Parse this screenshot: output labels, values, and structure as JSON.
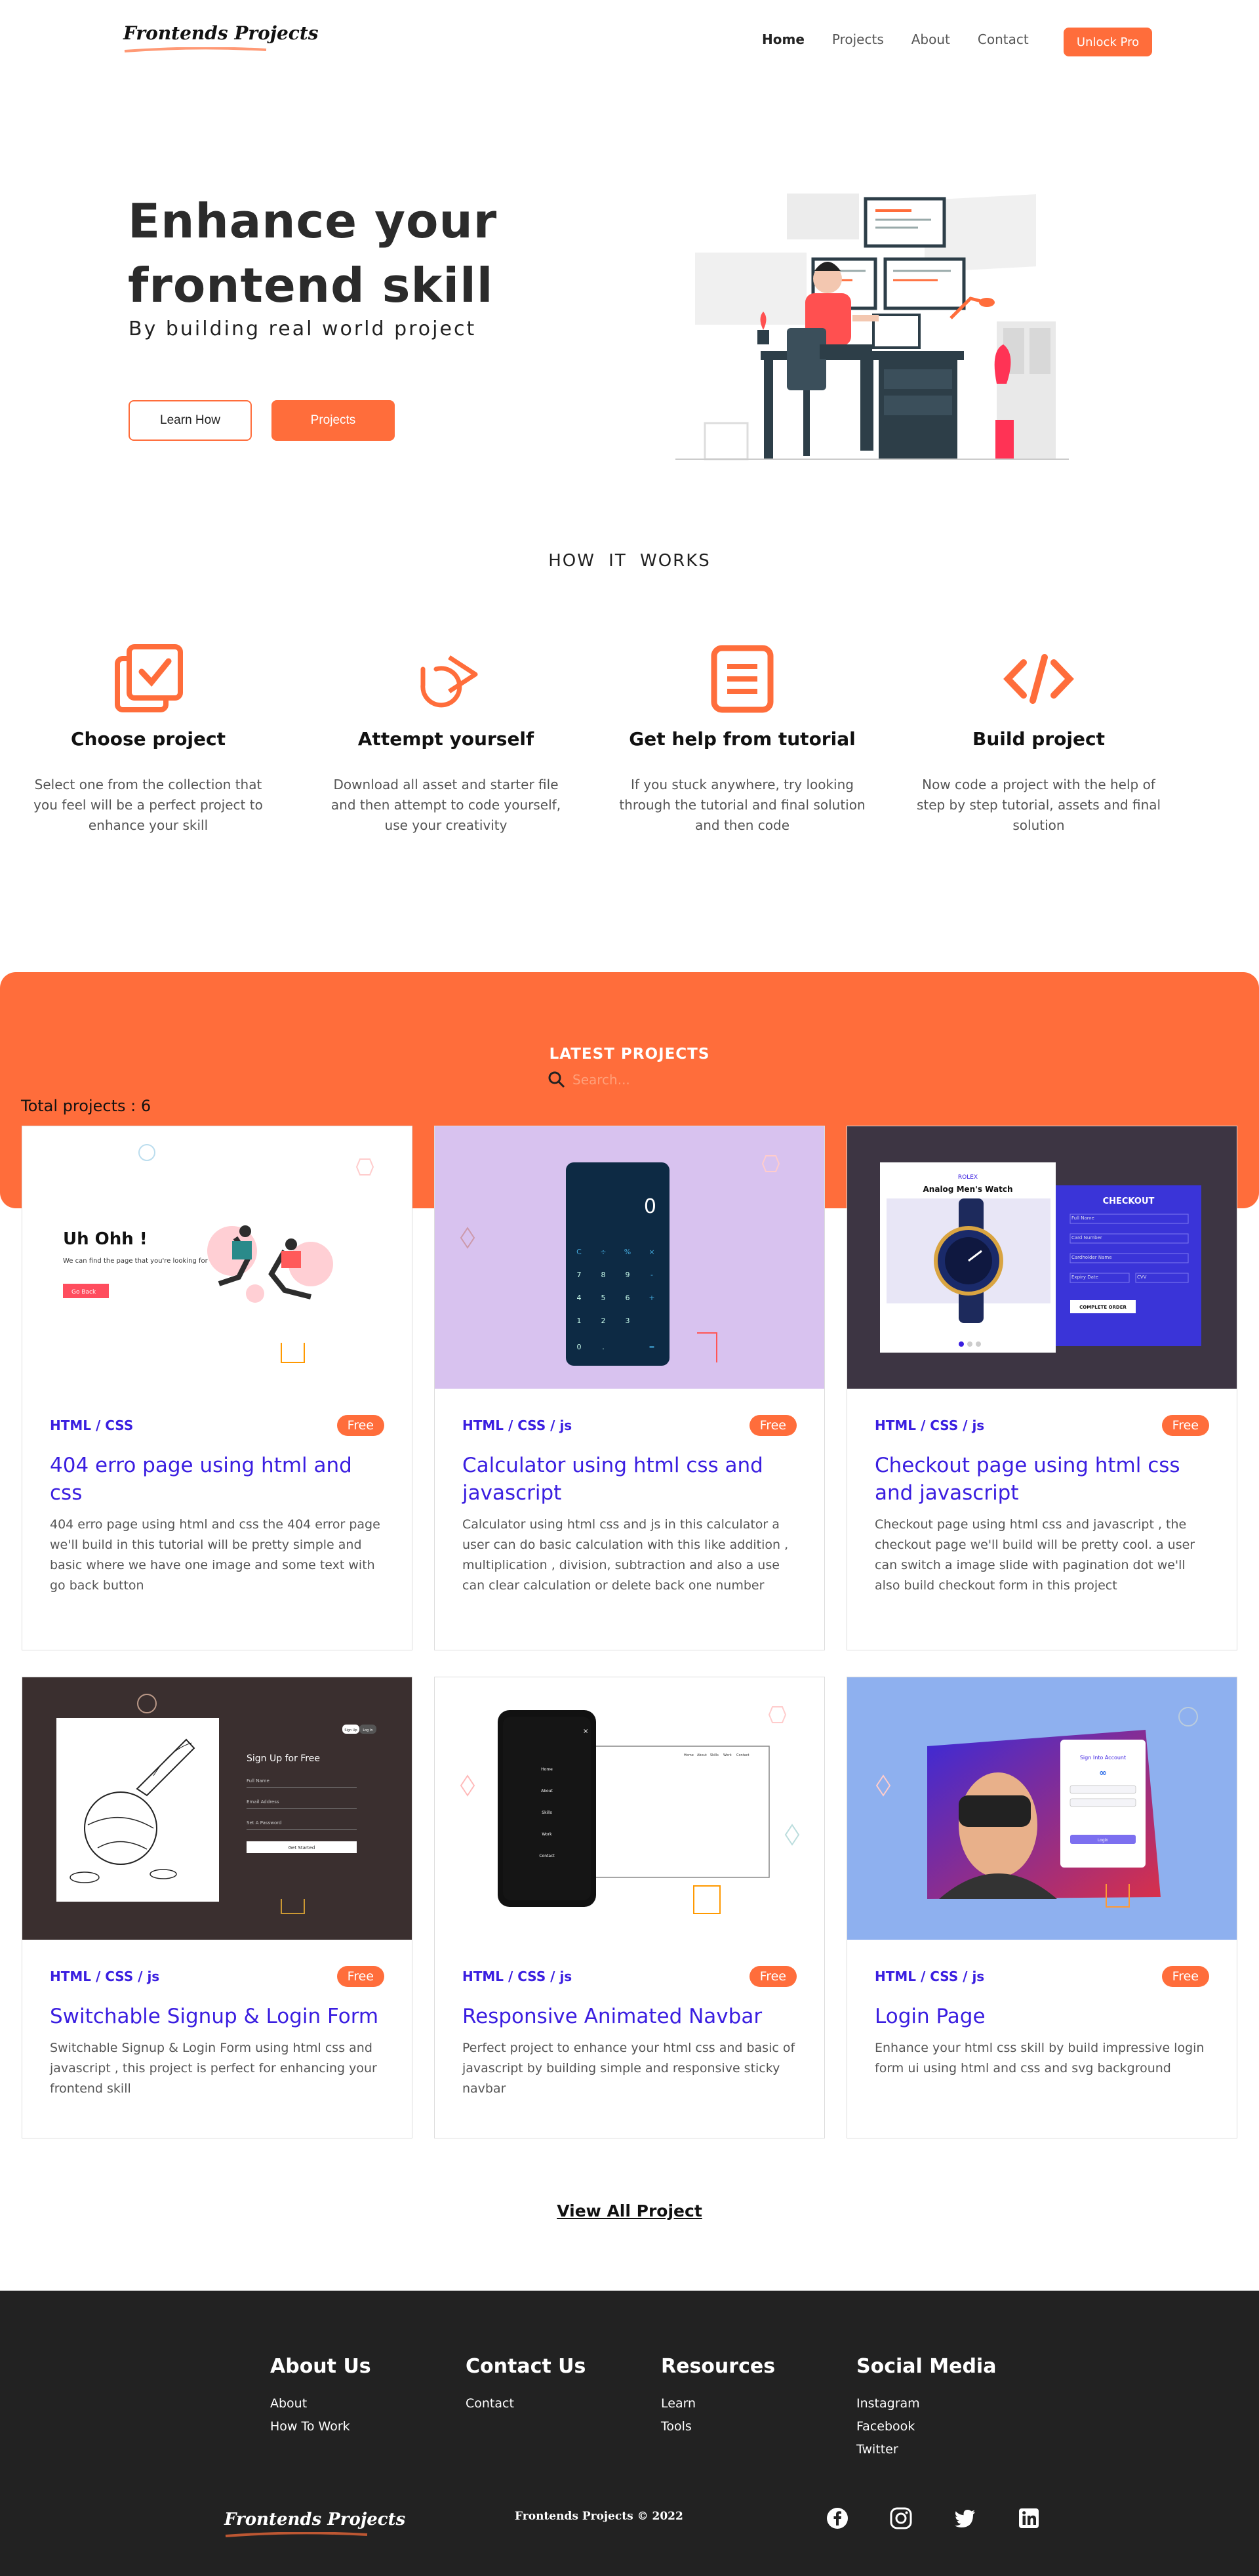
{
  "nav": {
    "logo": "Frontends Projects",
    "links": [
      "Home",
      "Projects",
      "About",
      "Contact"
    ],
    "cta": "Unlock Pro"
  },
  "hero": {
    "title": "Enhance your frontend skill",
    "subtitle": "By building real world project",
    "btn_learn": "Learn How",
    "btn_projects": "Projects"
  },
  "how": {
    "title": "HOW IT WORKS",
    "steps": [
      {
        "icon": "copy-check-icon",
        "title": "Choose project",
        "text": "Select one from the collection that you feel will be a perfect project to enhance your skill"
      },
      {
        "icon": "retry-arrow-icon",
        "title": "Attempt yourself",
        "text": "Download all asset and starter file and then attempt to code yourself, use your creativity"
      },
      {
        "icon": "document-icon",
        "title": "Get help from tutorial",
        "text": "If you stuck anywhere, try looking through the tutorial and final solution and then code"
      },
      {
        "icon": "code-icon",
        "title": "Build project",
        "text": "Now code a project with the help of step by step tutorial, assets and final solution"
      }
    ]
  },
  "latest": {
    "title": "LATEST PROJECTS",
    "search_placeholder": "Search...",
    "total": "Total projects : 6",
    "projects": [
      {
        "tech": "HTML / CSS",
        "badge": "Free",
        "title": "404 erro page using html and css",
        "desc": "404 erro page using html and css the 404 error page we'll build in this tutorial will be pretty simple and basic where we have one image and some text with go back button",
        "thumb": {
          "heading": "Uh Ohh !",
          "text": "We can find the page that you're looking for :(",
          "button": "Go Back"
        }
      },
      {
        "tech": "HTML / CSS / js",
        "badge": "Free",
        "title": "Calculator using html css and javascript",
        "desc": "Calculator using html css and js in this calculator a user can do basic calculation with this like addition , multiplication , division, subtraction and also a use can clear calculation or delete back one number",
        "thumb": {
          "display": "0",
          "keys": [
            "C",
            "÷",
            "%",
            "×",
            "7",
            "8",
            "9",
            "-",
            "4",
            "5",
            "6",
            "+",
            "1",
            "2",
            "3",
            "",
            "0",
            ".",
            "",
            "="
          ]
        }
      },
      {
        "tech": "HTML / CSS / js",
        "badge": "Free",
        "title": "Checkout page using html css and javascript",
        "desc": "Checkout page using html css and javascript , the checkout page we'll build will be pretty cool. a user can switch a image slide with pagination dot we'll also build checkout form in this project",
        "thumb": {
          "brand": "ROLEX",
          "product": "Analog Men's Watch",
          "checkout": "CHECKOUT",
          "fields": [
            "Full Name",
            "Card Number",
            "Cardholder Name",
            "Expiry Date",
            "CVV"
          ],
          "button": "COMPLETE ORDER"
        }
      },
      {
        "tech": "HTML / CSS / js",
        "badge": "Free",
        "title": "Switchable Signup & Login Form",
        "desc": "Switchable Signup & Login Form using html css and javascript , this project is perfect for enhancing your frontend skill",
        "thumb": {
          "heading": "Sign Up for Free",
          "tabs": [
            "Sign Up",
            "Log In"
          ],
          "fields": [
            "Full Name",
            "Email Address",
            "Set A Password"
          ],
          "button": "Get Started"
        }
      },
      {
        "tech": "HTML / CSS / js",
        "badge": "Free",
        "title": "Responsive Animated Navbar",
        "desc": "Perfect project to enhance your html css and basic of javascript by building simple and responsive sticky navbar",
        "thumb": {
          "menu": [
            "Home",
            "About",
            "Skills",
            "Work",
            "Contact"
          ]
        }
      },
      {
        "tech": "HTML / CSS / js",
        "badge": "Free",
        "title": "Login Page",
        "desc": "Enhance your html css skill by build impressive login form ui using html and css and svg background",
        "thumb": {
          "heading": "Sign Into Account",
          "button": "Login"
        }
      }
    ],
    "view_all": "View All Project"
  },
  "footer": {
    "columns": [
      {
        "title": "About Us",
        "links": [
          "About",
          "How To Work"
        ]
      },
      {
        "title": "Contact Us",
        "links": [
          "Contact"
        ]
      },
      {
        "title": "Resources",
        "links": [
          "Learn",
          "Tools"
        ]
      },
      {
        "title": "Social Media",
        "links": [
          "Instagram",
          "Facebook",
          "Twitter"
        ]
      }
    ],
    "logo": "Frontends Projects",
    "copyright": "Frontends Projects © 2022",
    "social_icons": [
      "facebook-icon",
      "instagram-icon",
      "twitter-icon",
      "linkedin-icon"
    ]
  },
  "colors": {
    "accent": "#ff6d3b",
    "link": "#3a1ee0",
    "footer_bg": "#222222"
  }
}
